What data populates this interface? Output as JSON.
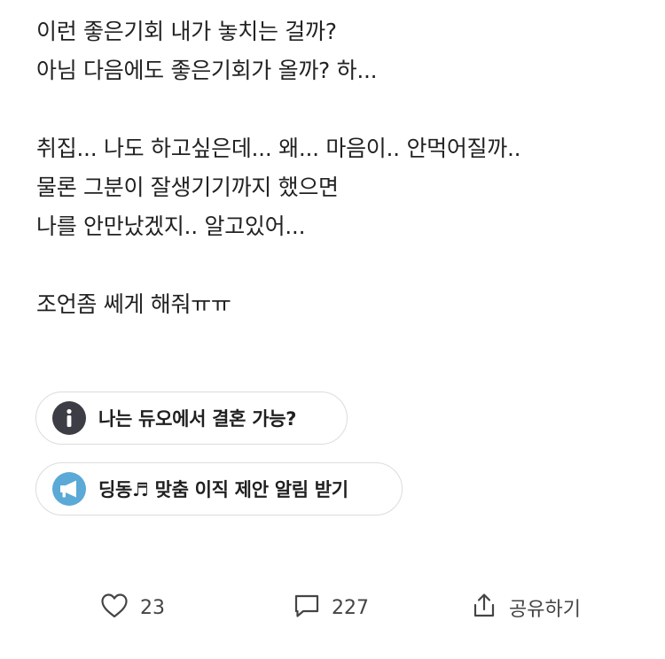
{
  "post": {
    "lines": [
      "이런 좋은기회 내가 놓치는 걸까?",
      "아님 다음에도 좋은기회가 올까? 하...",
      "",
      "취집... 나도 하고싶은데... 왜... 마음이.. 안먹어질까..",
      "물론 그분이 잘생기기까지 했으면",
      "나를 안만났겠지.. 알고있어...",
      "",
      "조언좀 쎄게 해줘ㅠㅠ"
    ]
  },
  "chips": {
    "duo": {
      "label": "나는 듀오에서 결혼 가능?",
      "icon": "info-icon",
      "icon_color": "#3d3d45"
    },
    "alarm": {
      "label": "딩동♬ 맞춤 이직 제안 알림 받기",
      "icon": "megaphone-icon",
      "icon_color": "#5aa9d6"
    }
  },
  "actions": {
    "like": {
      "icon": "heart-icon",
      "count": "23"
    },
    "comment": {
      "icon": "comment-icon",
      "count": "227"
    },
    "share": {
      "icon": "share-icon",
      "label": "공유하기"
    }
  }
}
